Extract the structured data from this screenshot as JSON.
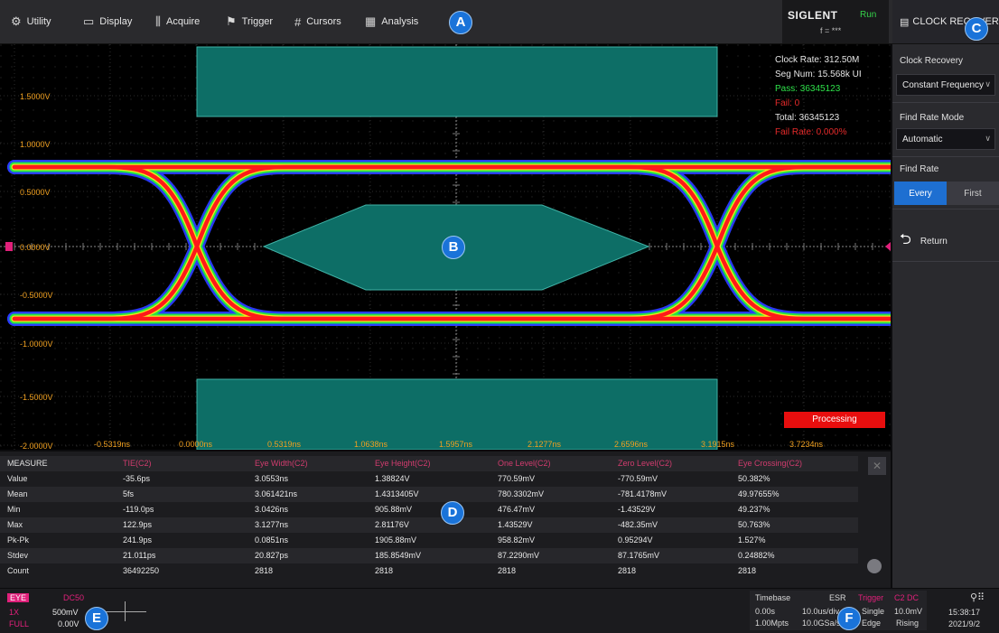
{
  "menu": {
    "items": [
      {
        "icon": "gear-icon",
        "glyph": "⚙",
        "label": "Utility"
      },
      {
        "icon": "monitor-icon",
        "glyph": "▭",
        "label": "Display"
      },
      {
        "icon": "acquire-icon",
        "glyph": "⫼",
        "label": "Acquire"
      },
      {
        "icon": "flag-icon",
        "glyph": "⚑",
        "label": "Trigger"
      },
      {
        "icon": "cursors-icon",
        "glyph": "#",
        "label": "Cursors"
      },
      {
        "icon": "analysis-icon",
        "glyph": "▦",
        "label": "Analysis"
      }
    ],
    "brand": "SIGLENT",
    "run_status": "Run",
    "freq": "f = ***",
    "panel_title": "CLOCK RECOVERY"
  },
  "callouts": {
    "a": "A",
    "b": "B",
    "c": "C",
    "d": "D",
    "e": "E",
    "f": "F"
  },
  "scope": {
    "y_labels": [
      "1.5000V",
      "1.0000V",
      "0.5000V",
      "0.0000V",
      "-0.5000V",
      "-1.0000V",
      "-1.5000V",
      "-2.0000V"
    ],
    "x_labels": [
      "-0.5319ns",
      "0.0000ns",
      "0.5319ns",
      "1.0638ns",
      "1.5957ns",
      "2.1277ns",
      "2.6596ns",
      "3.1915ns",
      "3.7234ns"
    ],
    "info": {
      "clock_rate": "Clock Rate: 312.50M",
      "seg_num": "Seg Num: 15.568k UI",
      "pass": "Pass: 36345123",
      "fail": "Fail: 0",
      "total": "Total: 36345123",
      "fail_rate": "Fail Rate: 0.000%"
    },
    "processing": "Processing",
    "colors": {
      "mask": "#0d6e66",
      "trace_red": "#ff1a1a",
      "trace_green": "#25e640",
      "trace_blue": "#2a3cff",
      "trace_yellow": "#f6e81a"
    }
  },
  "side": {
    "clock_recovery_label": "Clock Recovery",
    "clock_recovery_value": "Constant Frequency",
    "find_rate_mode_label": "Find Rate Mode",
    "find_rate_mode_value": "Automatic",
    "find_rate_label": "Find Rate",
    "find_rate_every": "Every",
    "find_rate_first": "First",
    "return_label": "Return"
  },
  "measure": {
    "row_label_header": "MEASURE",
    "headers": [
      "TIE(C2)",
      "Eye Width(C2)",
      "Eye Height(C2)",
      "One Level(C2)",
      "Zero Level(C2)",
      "Eye Crossing(C2)"
    ],
    "rows": [
      {
        "name": "Value",
        "cells": [
          "-35.6ps",
          "3.0553ns",
          "1.38824V",
          "770.59mV",
          "-770.59mV",
          "50.382%"
        ]
      },
      {
        "name": "Mean",
        "cells": [
          "5fs",
          "3.061421ns",
          "1.4313405V",
          "780.3302mV",
          "-781.4178mV",
          "49.97655%"
        ]
      },
      {
        "name": "Min",
        "cells": [
          "-119.0ps",
          "3.0426ns",
          "905.88mV",
          "476.47mV",
          "-1.43529V",
          "49.237%"
        ]
      },
      {
        "name": "Max",
        "cells": [
          "122.9ps",
          "3.1277ns",
          "2.81176V",
          "1.43529V",
          "-482.35mV",
          "50.763%"
        ]
      },
      {
        "name": "Pk-Pk",
        "cells": [
          "241.9ps",
          "0.0851ns",
          "1905.88mV",
          "958.82mV",
          "0.95294V",
          "1.527%"
        ]
      },
      {
        "name": "Stdev",
        "cells": [
          "21.011ps",
          "20.827ps",
          "185.8549mV",
          "87.2290mV",
          "87.1765mV",
          "0.24882%"
        ]
      },
      {
        "name": "Count",
        "cells": [
          "36492250",
          "2818",
          "2818",
          "2818",
          "2818",
          "2818"
        ]
      }
    ]
  },
  "status": {
    "eye_tag": "EYE",
    "eye_coupling": "DC50",
    "eye_scale_label": "1X",
    "eye_scale": "500mV",
    "eye_offset_label": "FULL",
    "eye_offset": "0.00V",
    "timebase_label": "Timebase",
    "esr_label": "ESR",
    "trigger_label": "Trigger",
    "trigger_channel": "C2 DC",
    "delay": "0.00s",
    "time_div": "10.0us/div",
    "mode": "Single",
    "level": "10.0mV",
    "mem_depth": "1.00Mpts",
    "sample_rate": "10.0GSa/s",
    "trigger_type": "Edge",
    "slope": "Rising",
    "time": "15:38:17",
    "date": "2021/9/2"
  }
}
